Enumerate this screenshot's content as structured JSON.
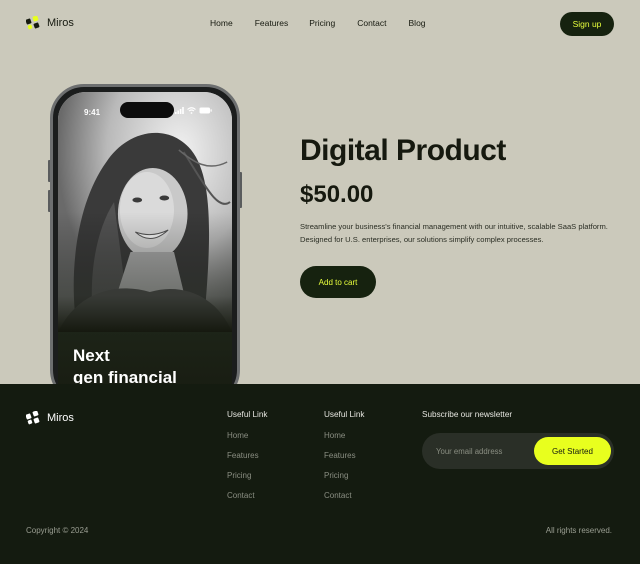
{
  "brand": {
    "name": "Miros"
  },
  "nav": {
    "links": [
      "Home",
      "Features",
      "Pricing",
      "Contact",
      "Blog"
    ],
    "signup_label": "Sign up"
  },
  "phone": {
    "time": "9:41",
    "caption_line1": "Next",
    "caption_line2": "gen financial"
  },
  "product": {
    "title": "Digital Product",
    "price": "$50.00",
    "description": "Streamline your business's financial management with our intuitive, scalable SaaS platform. Designed for U.S. enterprises, our solutions simplify complex processes.",
    "cart_label": "Add to cart"
  },
  "footer": {
    "brand_name": "Miros",
    "columns": [
      {
        "title": "Useful Link",
        "links": [
          "Home",
          "Features",
          "Pricing",
          "Contact"
        ]
      },
      {
        "title": "Useful Link",
        "links": [
          "Home",
          "Features",
          "Pricing",
          "Contact"
        ]
      }
    ],
    "newsletter": {
      "title": "Subscribe our newsletter",
      "placeholder": "Your email address",
      "button_label": "Get Started"
    },
    "copyright": "Copyright © 2024",
    "rights": "All rights reserved."
  },
  "colors": {
    "background": "#cbc9bb",
    "dark": "#16220f",
    "accent": "#e8ff1e",
    "footer_bg": "#141b10"
  },
  "icons": {
    "logo": "logo-icon",
    "signal": "signal-icon",
    "wifi": "wifi-icon",
    "battery": "battery-icon"
  }
}
